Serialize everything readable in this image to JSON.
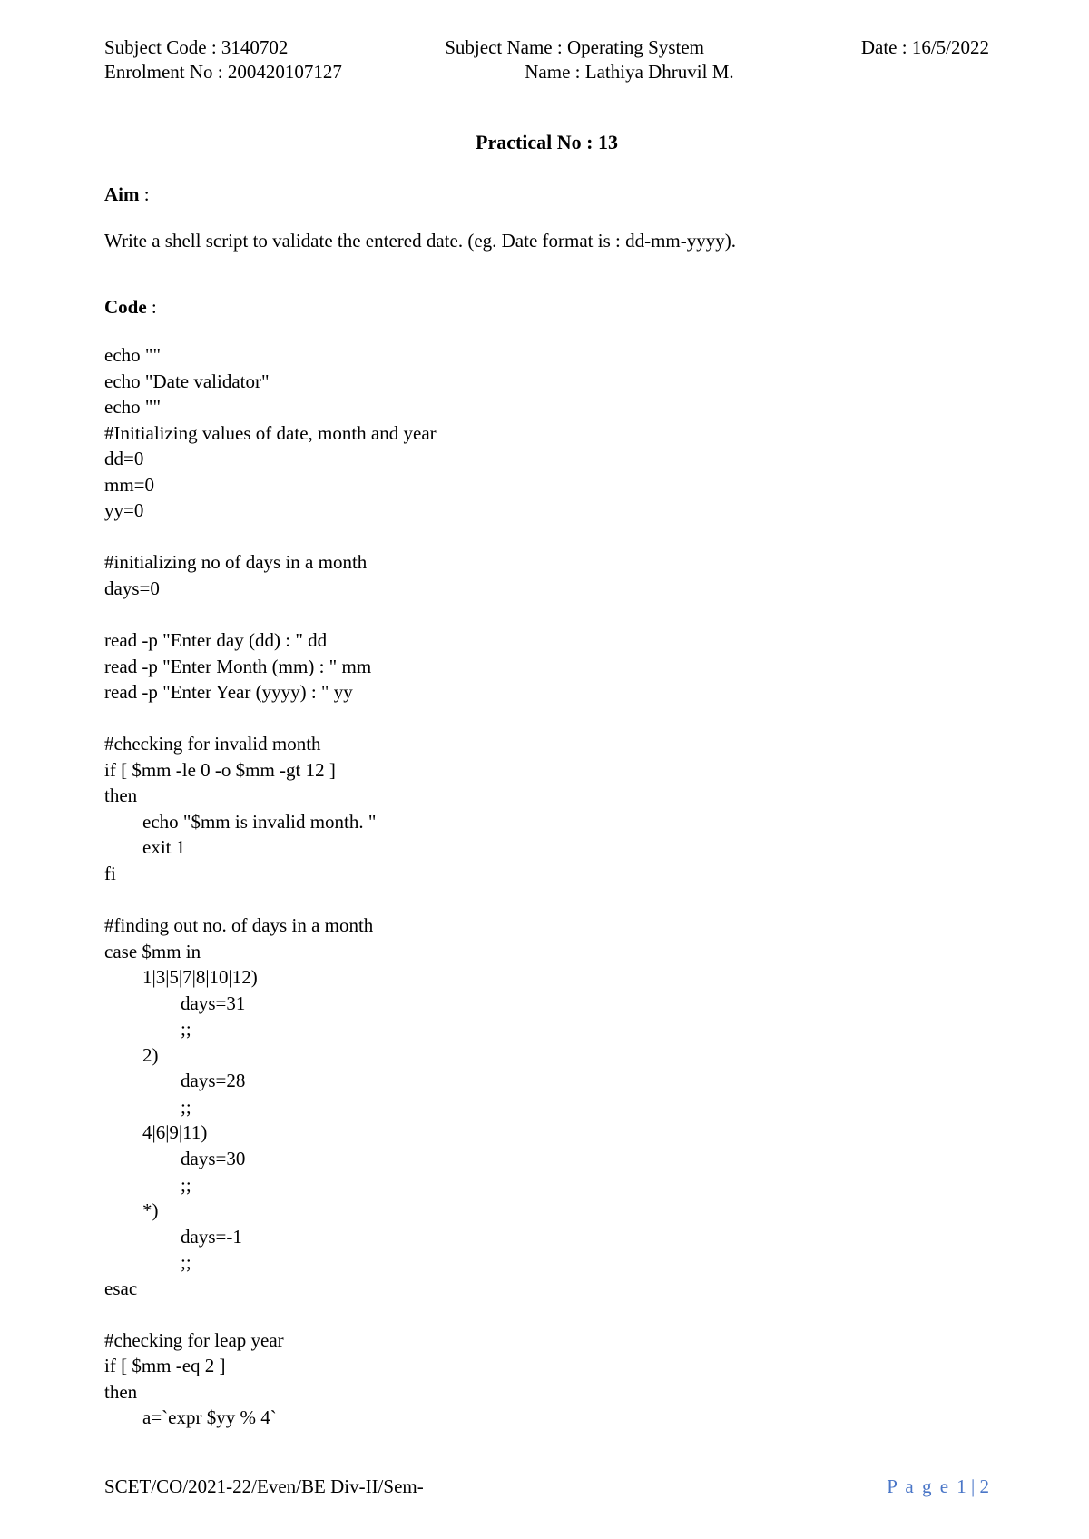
{
  "header": {
    "subject_code_label": "Subject Code : ",
    "subject_code": "3140702",
    "enrolment_label": "Enrolment No : ",
    "enrolment_no": "200420107127",
    "subject_name_label": "Subject Name : ",
    "subject_name": "Operating System",
    "name_label": "Name : ",
    "name": "Lathiya Dhruvil M.",
    "date_label": "Date : ",
    "date": "16/5/2022"
  },
  "title": "Practical No : 13",
  "aim_label": "Aim",
  "aim_text": "Write a shell script to validate the entered date. (eg. Date format is : dd-mm-yyyy).",
  "code_label": "Code",
  "code": "echo \"\"\necho \"Date validator\"\necho \"\"\n#Initializing values of date, month and year\ndd=0\nmm=0\nyy=0\n\n#initializing no of days in a month\ndays=0\n\nread -p \"Enter day (dd) : \" dd\nread -p \"Enter Month (mm) : \" mm\nread -p \"Enter Year (yyyy) : \" yy\n\n#checking for invalid month\nif [ $mm -le 0 -o $mm -gt 12 ]\nthen\n        echo \"$mm is invalid month. \"\n        exit 1\nfi\n\n#finding out no. of days in a month\ncase $mm in\n        1|3|5|7|8|10|12)\n                days=31\n                ;;\n        2)\n                days=28\n                ;;\n        4|6|9|11)\n                days=30\n                ;;\n        *)\n                days=-1\n                ;;\nesac\n\n#checking for leap year\nif [ $mm -eq 2 ]\nthen\n        a=`expr $yy % 4`",
  "footer": {
    "left": "SCET/CO/2021-22/Even/BE Div-II/Sem-",
    "page_label": "P a g e ",
    "page_num": "1 | 2"
  }
}
